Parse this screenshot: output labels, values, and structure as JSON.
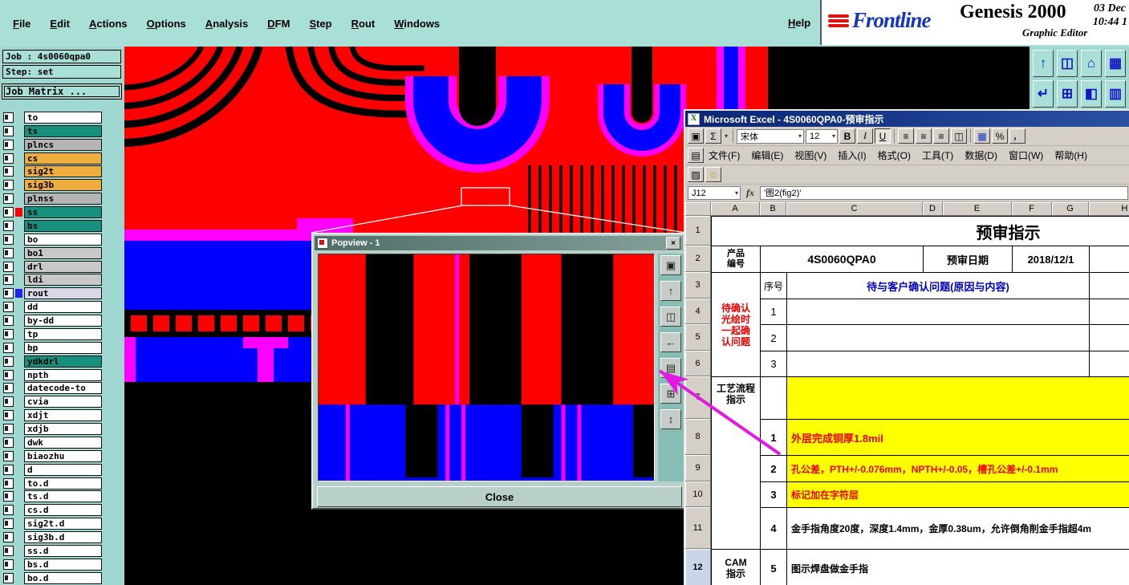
{
  "menubar": {
    "items": [
      {
        "label": "File"
      },
      {
        "label": "Edit"
      },
      {
        "label": "Actions"
      },
      {
        "label": "Options"
      },
      {
        "label": "Analysis"
      },
      {
        "label": "DFM"
      },
      {
        "label": "Step"
      },
      {
        "label": "Rout"
      },
      {
        "label": "Windows"
      }
    ],
    "help": "Help"
  },
  "logo": {
    "brand": "Frontline",
    "product": "Genesis 2000",
    "date": "03 Dec",
    "time": "10:44 1",
    "subtitle": "Graphic Editor"
  },
  "job_panel": {
    "job_label": "Job : 4s0060qpa0",
    "step_label": "Step: set",
    "matrix_button": "Job Matrix ..."
  },
  "layers": [
    {
      "name": "to",
      "bg": "#ffffff",
      "mark": ""
    },
    {
      "name": "ts",
      "bg": "#17907e",
      "mark": ""
    },
    {
      "name": "plncs",
      "bg": "#b5b5b5",
      "mark": ""
    },
    {
      "name": "cs",
      "bg": "#eead3d",
      "mark": ""
    },
    {
      "name": "sig2t",
      "bg": "#eead3d",
      "mark": ""
    },
    {
      "name": "sig3b",
      "bg": "#eead3d",
      "mark": ""
    },
    {
      "name": "plnss",
      "bg": "#b5b5b5",
      "mark": ""
    },
    {
      "name": "ss",
      "bg": "#17907e",
      "mark": "#ff0000"
    },
    {
      "name": "bs",
      "bg": "#17907e",
      "mark": ""
    },
    {
      "name": "bo",
      "bg": "#ffffff",
      "mark": ""
    },
    {
      "name": "bo1",
      "bg": "#c9c9c9",
      "mark": ""
    },
    {
      "name": "drl",
      "bg": "#c9c9c9",
      "mark": ""
    },
    {
      "name": "ldi",
      "bg": "#c9c9c9",
      "mark": ""
    },
    {
      "name": "rout",
      "bg": "#d8d8e6",
      "mark": "#2222ee"
    },
    {
      "name": "dd",
      "bg": "#ffffff",
      "mark": ""
    },
    {
      "name": "by-dd",
      "bg": "#ffffff",
      "mark": ""
    },
    {
      "name": "tp",
      "bg": "#ffffff",
      "mark": ""
    },
    {
      "name": "bp",
      "bg": "#ffffff",
      "mark": ""
    },
    {
      "name": "ydkdrl",
      "bg": "#17907e",
      "mark": ""
    },
    {
      "name": "npth",
      "bg": "#ffffff",
      "mark": ""
    },
    {
      "name": "datecode-to",
      "bg": "#ffffff",
      "mark": ""
    },
    {
      "name": "cvia",
      "bg": "#ffffff",
      "mark": ""
    },
    {
      "name": "xdjt",
      "bg": "#ffffff",
      "mark": ""
    },
    {
      "name": "xdjb",
      "bg": "#ffffff",
      "mark": ""
    },
    {
      "name": "dwk",
      "bg": "#ffffff",
      "mark": ""
    },
    {
      "name": "biaozhu",
      "bg": "#ffffff",
      "mark": ""
    },
    {
      "name": "d",
      "bg": "#ffffff",
      "mark": ""
    },
    {
      "name": "to.d",
      "bg": "#ffffff",
      "mark": ""
    },
    {
      "name": "ts.d",
      "bg": "#ffffff",
      "mark": ""
    },
    {
      "name": "cs.d",
      "bg": "#ffffff",
      "mark": ""
    },
    {
      "name": "sig2t.d",
      "bg": "#ffffff",
      "mark": ""
    },
    {
      "name": "sig3b.d",
      "bg": "#ffffff",
      "mark": ""
    },
    {
      "name": "ss.d",
      "bg": "#ffffff",
      "mark": ""
    },
    {
      "name": "bs.d",
      "bg": "#ffffff",
      "mark": ""
    },
    {
      "name": "bo.d",
      "bg": "#ffffff",
      "mark": ""
    }
  ],
  "genesis_toolbar": [
    {
      "icon": "↑"
    },
    {
      "icon": "◫"
    },
    {
      "icon": "⌂"
    },
    {
      "icon": "▦"
    },
    {
      "icon": "↵"
    },
    {
      "icon": "⊞"
    },
    {
      "icon": "◧"
    },
    {
      "icon": "▥"
    }
  ],
  "popview": {
    "title": "Popview - 1",
    "close_x": "×",
    "close_label": "Close",
    "buttons": [
      {
        "icon": "▣"
      },
      {
        "icon": "↑"
      },
      {
        "icon": "◫"
      },
      {
        "icon": "←"
      },
      {
        "icon": "▤"
      },
      {
        "icon": "⊞"
      },
      {
        "icon": "↕"
      }
    ]
  },
  "excel": {
    "title": "Microsoft Excel - 4S0060QPA0-预审指示",
    "title_icon": "X",
    "menus": [
      {
        "label": "文件(F)"
      },
      {
        "label": "编辑(E)"
      },
      {
        "label": "视图(V)"
      },
      {
        "label": "插入(I)"
      },
      {
        "label": "格式(O)"
      },
      {
        "label": "工具(T)"
      },
      {
        "label": "数据(D)"
      },
      {
        "label": "窗口(W)"
      },
      {
        "label": "帮助(H)"
      }
    ],
    "toolbar": {
      "save_icon": "▣",
      "sum": "Σ",
      "dropdown": "▾",
      "font_name": "宋体",
      "font_size": "12",
      "bold": "B",
      "italic": "I",
      "underline": "U",
      "align_left": "≡",
      "align_center": "≡",
      "align_right": "≡",
      "merge": "◫",
      "fill": "▦",
      "percent": "%",
      "comma": "，",
      "sheet_icon": "▤",
      "pin1": "▨",
      "pin2": "☆"
    },
    "formula_bar": {
      "name_box": "J12",
      "fx": "fx",
      "formula": "'图2(fig2)'"
    },
    "columns": [
      "A",
      "B",
      "C",
      "D",
      "E",
      "F",
      "G",
      "H"
    ],
    "row_numbers": [
      "1",
      "2",
      "3",
      "4",
      "5",
      "6",
      "7",
      "8",
      "9",
      "10",
      "11",
      "12"
    ],
    "sheet": {
      "title": "预审指示",
      "product_label": "产品\n编号",
      "product_value": "4S0060QPA0",
      "review_date_label": "预审日期",
      "review_date_value": "2018/12/1",
      "review_partial": "预审",
      "seq_header": "序号",
      "confirm_header": "待与客户确认问题(原因与内容)",
      "confirm_side_label": "待确认\n光绘时\n一起确\n认问题",
      "confirm_rows": [
        {
          "no": "1"
        },
        {
          "no": "2"
        },
        {
          "no": "3"
        }
      ],
      "process_side_label": "工艺流程\n指示",
      "cam_side_label": "CAM\n指示",
      "process_rows": [
        {
          "no": "1",
          "text": "外层完成铜厚1.8mil"
        },
        {
          "no": "2",
          "text": "孔公差，PTH+/-0.076mm，NPTH+/-0.05，槽孔公差+/-0.1mm"
        },
        {
          "no": "3",
          "text": "标记加在字符层"
        },
        {
          "no": "4",
          "text": "金手指角度20度，深度1.4mm，金厚0.38um，允许倒角削金手指超4m"
        },
        {
          "no": "5",
          "text": "图示焊盘做金手指"
        }
      ]
    }
  },
  "colors": {
    "teal_bg": "#9fd8d0",
    "pcb_red": "#ff0000",
    "pcb_blue": "#0000ff",
    "pcb_magenta": "#ff00ff",
    "highlight_yellow": "#ffff00",
    "annotation_arrow": "#e319e3"
  }
}
